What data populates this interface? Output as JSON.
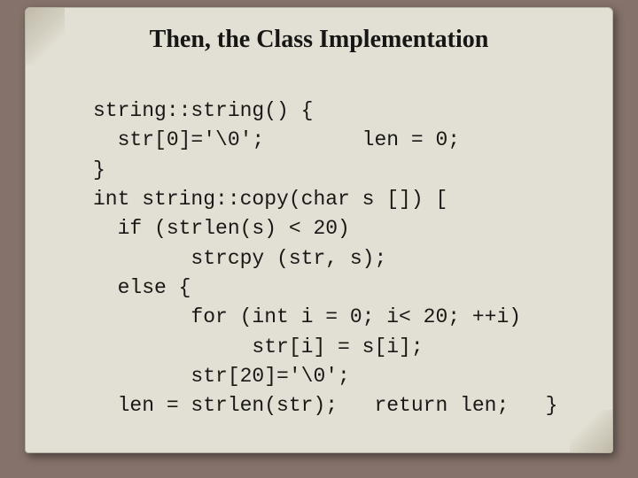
{
  "title": "Then, the Class Implementation",
  "code_lines": [
    "string::string() {",
    "  str[0]='\\0';        len = 0;",
    "}",
    "int string::copy(char s []) [",
    "  if (strlen(s) < 20)",
    "        strcpy (str, s);",
    "  else {",
    "        for (int i = 0; i< 20; ++i)",
    "             str[i] = s[i];",
    "        str[20]='\\0';",
    "  len = strlen(str);   return len;   }"
  ]
}
